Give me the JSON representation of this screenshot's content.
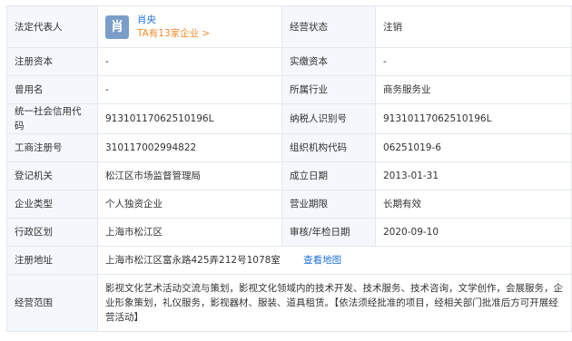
{
  "legal_rep": {
    "label": "法定代表人",
    "avatar_char": "肖",
    "name": "肖央",
    "companies_link": "TA有13家企业 >"
  },
  "rows": [
    {
      "k1": "经营状态",
      "v1": "注销"
    },
    {
      "k1": "注册资本",
      "v1": "-",
      "k2": "实缴资本",
      "v2": "-"
    },
    {
      "k1": "曾用名",
      "v1": "-",
      "k2": "所属行业",
      "v2": "商务服务业"
    },
    {
      "k1": "统一社会信用代码",
      "v1": "91310117062510196L",
      "k2": "纳税人识别号",
      "v2": "91310117062510196L"
    },
    {
      "k1": "工商注册号",
      "v1": "310117002994822",
      "k2": "组织机构代码",
      "v2": "06251019-6"
    },
    {
      "k1": "登记机关",
      "v1": "松江区市场监督管理局",
      "k2": "成立日期",
      "v2": "2013-01-31"
    },
    {
      "k1": "企业类型",
      "v1": "个人独资企业",
      "k2": "营业期限",
      "v2": "长期有效"
    },
    {
      "k1": "行政区划",
      "v1": "上海市松江区",
      "k2": "审核/年检日期",
      "v2": "2020-09-10"
    }
  ],
  "address": {
    "label": "注册地址",
    "value": "上海市松江区富永路425弄212号1078室",
    "map_link": "查看地图"
  },
  "scope": {
    "label": "经营范围",
    "value": "影视文化艺术活动交流与策划，影视文化领域内的技术开发、技术服务、技术咨询，文学创作，会展服务，企业形象策划，礼仪服务，影视器材、服装、道具租赁。【依法须经批准的项目，经相关部门批准后方可开展经营活动】"
  },
  "colors": {
    "label_bg": "#f4f7fb",
    "border": "#e4e8ee",
    "link_blue": "#1e6fd9",
    "link_orange": "#f08c2e",
    "avatar_bg": "#7a9ec8"
  }
}
